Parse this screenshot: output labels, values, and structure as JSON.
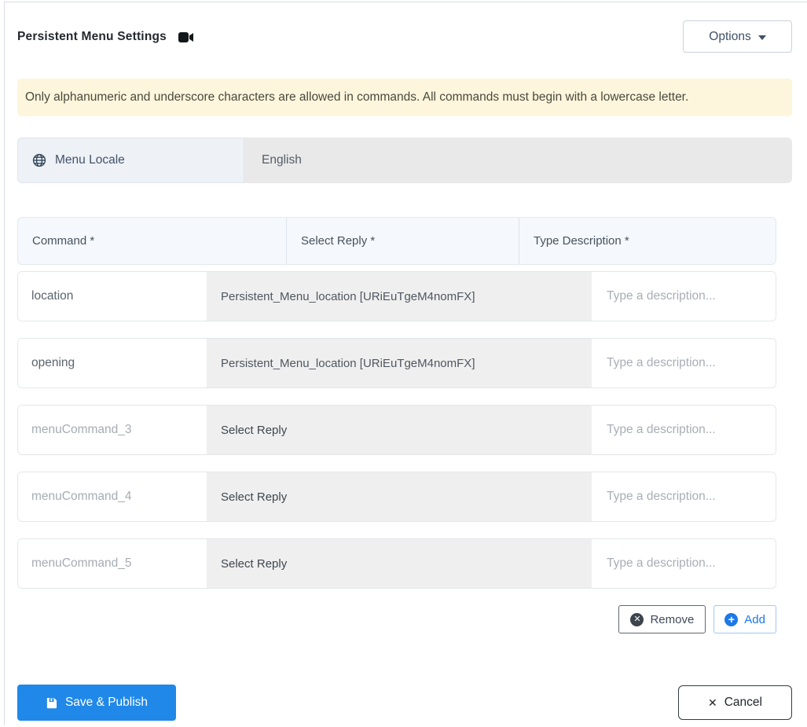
{
  "header": {
    "title": "Persistent Menu Settings",
    "title_icon": "video-camera-icon",
    "options_button": {
      "label": "Options",
      "icon": "caret-down-icon"
    }
  },
  "alert": {
    "text": "Only alphanumeric and underscore characters are allowed in commands. All commands must begin with a lowercase letter."
  },
  "locale": {
    "icon": "globe-icon",
    "label": "Menu Locale",
    "value": "English"
  },
  "table": {
    "columns": [
      "Command *",
      "Select Reply *",
      "Type Description *"
    ],
    "description_placeholder": "Type a description...",
    "rows": [
      {
        "command": "location",
        "command_filled": true,
        "reply": "Persistent_Menu_location [URiEuTgeM4nomFX]",
        "reply_filled": true
      },
      {
        "command": "opening",
        "command_filled": true,
        "reply": "Persistent_Menu_location [URiEuTgeM4nomFX]",
        "reply_filled": true
      },
      {
        "command": "menuCommand_3",
        "command_filled": false,
        "reply": "Select Reply",
        "reply_filled": false
      },
      {
        "command": "menuCommand_4",
        "command_filled": false,
        "reply": "Select Reply",
        "reply_filled": false
      },
      {
        "command": "menuCommand_5",
        "command_filled": false,
        "reply": "Select Reply",
        "reply_filled": false
      }
    ],
    "actions": {
      "remove": "Remove",
      "add": "Add"
    }
  },
  "footer": {
    "save": "Save & Publish",
    "save_icon": "save-icon",
    "cancel": "Cancel",
    "cancel_icon": "cancel-x-icon"
  },
  "colors": {
    "primary_blue": "#2088e9",
    "add_blue": "#1d78e8",
    "alert_bg": "#fdf6dc",
    "alert_text": "#4b483e",
    "table_header_bg": "#f5f8fc",
    "reply_cell_bg": "#efefef",
    "locale_label_bg": "#eef1f6",
    "locale_value_bg": "#e9e9e9",
    "card_border": "#d9dde2"
  }
}
